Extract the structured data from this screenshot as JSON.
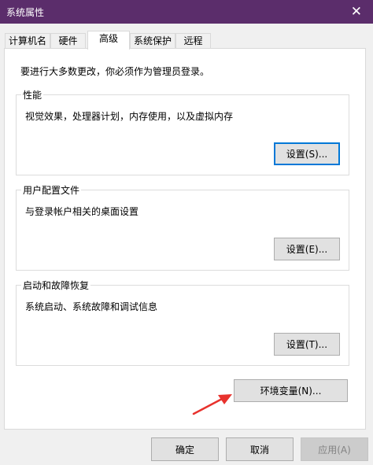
{
  "window": {
    "title": "系统属性",
    "close_glyph": "✕"
  },
  "tabs": [
    {
      "label": "计算机名",
      "active": false
    },
    {
      "label": "硬件",
      "active": false
    },
    {
      "label": "高级",
      "active": true
    },
    {
      "label": "系统保护",
      "active": false
    },
    {
      "label": "远程",
      "active": false
    }
  ],
  "admin_note": "要进行大多数更改，你必须作为管理员登录。",
  "performance": {
    "title": "性能",
    "description": "视觉效果，处理器计划，内存使用，以及虚拟内存",
    "button": "设置(S)..."
  },
  "user_profiles": {
    "title": "用户配置文件",
    "description": "与登录帐户相关的桌面设置",
    "button": "设置(E)..."
  },
  "startup_recovery": {
    "title": "启动和故障恢复",
    "description": "系统启动、系统故障和调试信息",
    "button": "设置(T)..."
  },
  "env_button": "环境变量(N)...",
  "footer": {
    "ok": "确定",
    "cancel": "取消",
    "apply": "应用(A)"
  },
  "colors": {
    "titlebar": "#5b2d6b",
    "focus": "#0078d7",
    "arrow": "#e8322d"
  },
  "icons": {
    "close": "close-icon",
    "annotation": "red-arrow-icon"
  }
}
